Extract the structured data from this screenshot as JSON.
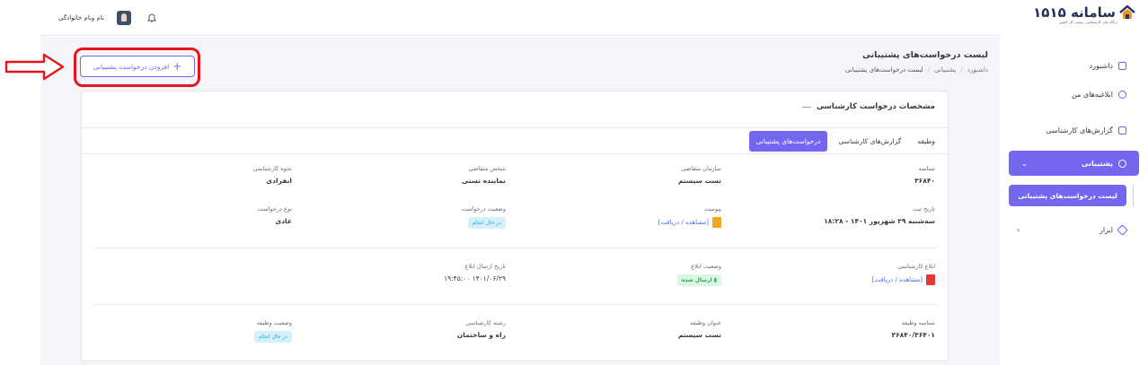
{
  "topbar": {
    "user_name": "نام ونام خانوادگی"
  },
  "sidebar": {
    "logo_text": "سامانه ۱۵۱۵",
    "logo_sub": "درگاه ملی کارشناسی رسمی کل کشور",
    "items": [
      {
        "label": "داشبورد",
        "icon": "home-icon"
      },
      {
        "label": "ابلاغیه‌های من",
        "icon": "chat-icon"
      },
      {
        "label": "گزارش‌های کارشناسی",
        "icon": "report-icon"
      },
      {
        "label": "پشتیبانی",
        "icon": "support-icon",
        "chevron": "⌄"
      },
      {
        "label": "ابزار",
        "icon": "tool-icon",
        "chevron": "‹"
      }
    ],
    "sub_item": "لیست درخواست‌های پشتیبانی"
  },
  "header": {
    "title": "لیست درخواست‌های پشتیبانی",
    "breadcrumb": [
      "داشبورد",
      "پشتیبانی",
      "لیست درخواست‌های پشتیبانی"
    ],
    "separator": "/",
    "add_button": "افزودن درخواست پشتیبانی",
    "add_plus": "+"
  },
  "card": {
    "title": "مشخصات درخواست کارشناسی",
    "tabs": [
      "وظیفه",
      "گزارش‌های کارشناسی",
      "درخواست‌های پشتیبانی"
    ],
    "rows": [
      {
        "label": "شناسه",
        "value": "۳۶۸۴۰"
      },
      {
        "label": "سازمان متقاضی",
        "value": "تست سیستم"
      },
      {
        "label": "شخص متقاضی",
        "value": "نماینده تستی"
      },
      {
        "label": "نحوه کارشناسی",
        "value": "انفرادی"
      },
      {
        "label": "تاریخ ثبت",
        "value": "سه‌شنبه ۲۹ شهریور ۱۴۰۱ - ۱۸:۲۸"
      },
      {
        "label": "پیوست",
        "value": "[مشاهده / دریافت]"
      },
      {
        "label": "وضعیت درخواست",
        "value": "در حال انجام"
      },
      {
        "label": "نوع درخواست",
        "value": "عادی"
      },
      {
        "label": "ابلاغ کارشناسی",
        "value": "[مشاهده / دریافت]"
      },
      {
        "label": "وضعیت ابلاغ",
        "value": "ارسال شده"
      },
      {
        "label": "تاریخ ارسال ابلاغ",
        "value": "۱۴۰۱/۰۶/۲۹ ۱۹:۴۵:۰۰"
      },
      {
        "label": "شناسه وظیفه",
        "value": "۳۶۸۴۰/۳۶۴۰۱"
      },
      {
        "label": "عنوان وظیفه",
        "value": "تست سیستم"
      },
      {
        "label": "رشته کارشناسی",
        "value": "راه و ساختمان"
      },
      {
        "label": "وضعیت وظیفه",
        "value": "در حال انجام"
      }
    ]
  },
  "colors": {
    "accent": "#7367f0",
    "highlight": "#e8141b",
    "pdf": "#e53935",
    "doc": "#f5a623"
  }
}
